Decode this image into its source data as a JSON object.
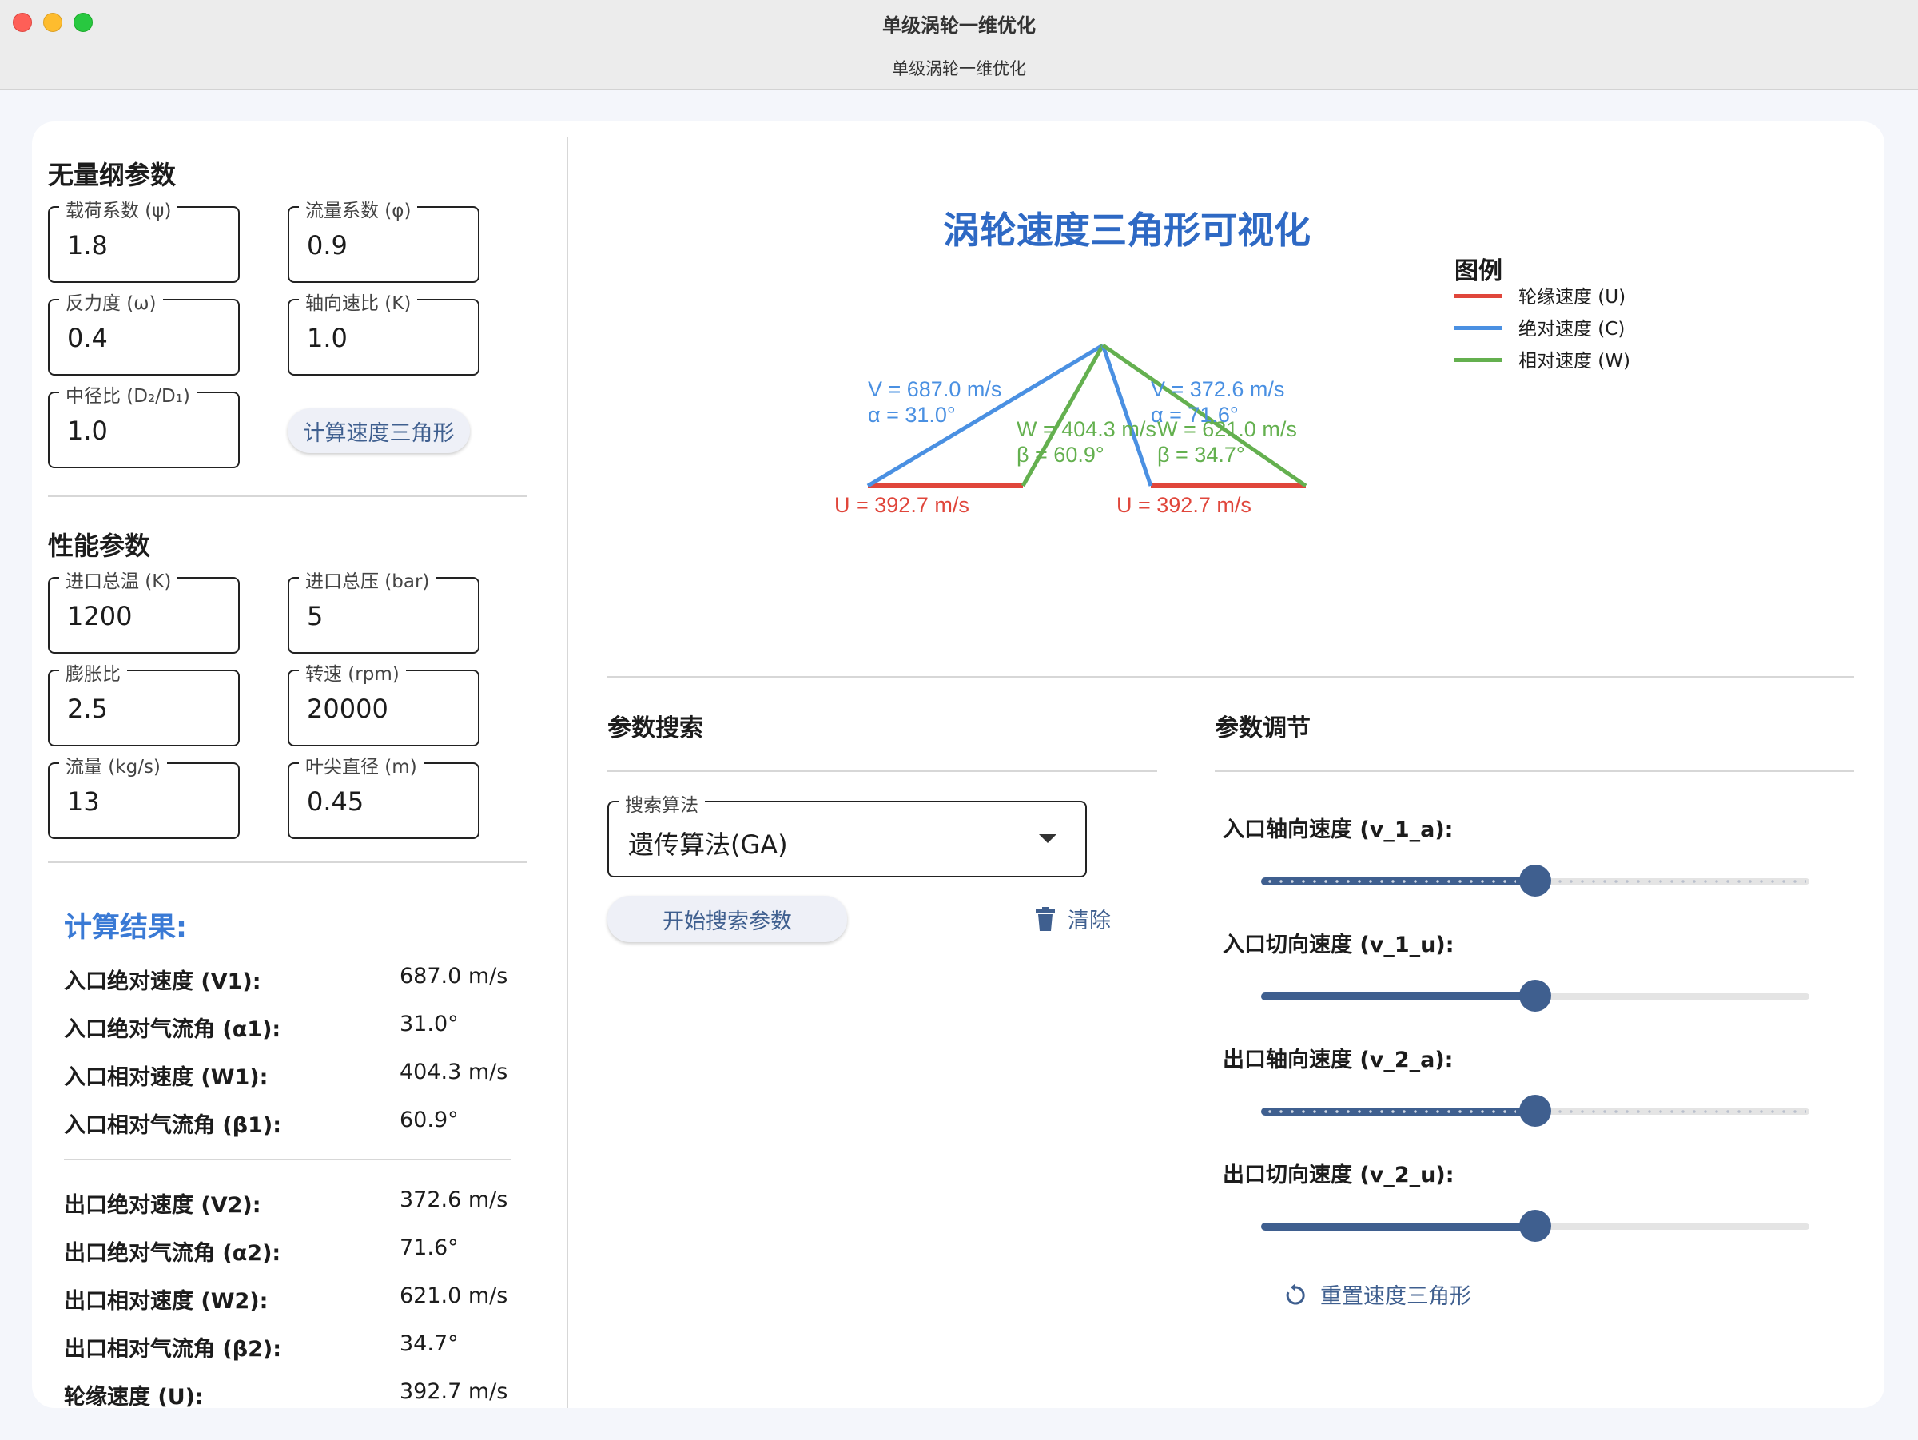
{
  "window": {
    "title": "单级涡轮一维优化",
    "subtitle": "单级涡轮一维优化"
  },
  "dimensionless": {
    "title": "无量纲参数",
    "fields": [
      {
        "label": "载荷系数 (ψ)",
        "value": "1.8"
      },
      {
        "label": "流量系数 (φ)",
        "value": "0.9"
      },
      {
        "label": "反力度 (ω)",
        "value": "0.4"
      },
      {
        "label": "轴向速比 (K)",
        "value": "1.0"
      },
      {
        "label": "中径比 (D₂/D₁)",
        "value": "1.0"
      }
    ],
    "calc_button": "计算速度三角形"
  },
  "performance": {
    "title": "性能参数",
    "fields": [
      {
        "label": "进口总温 (K)",
        "value": "1200"
      },
      {
        "label": "进口总压 (bar)",
        "value": "5"
      },
      {
        "label": "膨胀比",
        "value": "2.5"
      },
      {
        "label": "转速 (rpm)",
        "value": "20000"
      },
      {
        "label": "流量 (kg/s)",
        "value": "13"
      },
      {
        "label": "叶尖直径 (m)",
        "value": "0.45"
      }
    ]
  },
  "results": {
    "title": "计算结果:",
    "rows": [
      {
        "label": "入口绝对速度 (V1):",
        "value": "687.0 m/s"
      },
      {
        "label": "入口绝对气流角 (α1):",
        "value": "31.0°"
      },
      {
        "label": "入口相对速度 (W1):",
        "value": "404.3 m/s"
      },
      {
        "label": "入口相对气流角 (β1):",
        "value": "60.9°"
      },
      {
        "label": "出口绝对速度 (V2):",
        "value": "372.6 m/s"
      },
      {
        "label": "出口绝对气流角 (α2):",
        "value": "71.6°"
      },
      {
        "label": "出口相对速度 (W2):",
        "value": "621.0 m/s"
      },
      {
        "label": "出口相对气流角 (β2):",
        "value": "34.7°"
      },
      {
        "label": "轮缘速度 (U):",
        "value": "392.7 m/s"
      }
    ]
  },
  "chart": {
    "title": "涡轮速度三角形可视化",
    "legend_title": "图例",
    "legend": [
      {
        "label": "轮缘速度 (U)",
        "color": "#e0463b"
      },
      {
        "label": "绝对速度 (C)",
        "color": "#4a90e2"
      },
      {
        "label": "相对速度 (W)",
        "color": "#64b04f"
      }
    ],
    "inlet": {
      "v_label": "V = 687.0 m/s",
      "a_label": "α = 31.0°",
      "w_label": "W = 404.3 m/s",
      "b_label": "β = 60.9°",
      "u_label": "U = 392.7 m/s"
    },
    "outlet": {
      "v_label": "V = 372.6 m/s",
      "a_label": "α = 71.6°",
      "w_label": "W = 621.0 m/s",
      "b_label": "β = 34.7°",
      "u_label": "U = 392.7 m/s"
    },
    "colors": {
      "u": "#e0463b",
      "c": "#4a90e2",
      "w": "#64b04f"
    }
  },
  "search": {
    "title": "参数搜索",
    "algo_label": "搜索算法",
    "algo_value": "遗传算法(GA)",
    "start_button": "开始搜索参数",
    "clear_button": "清除"
  },
  "tuning": {
    "title": "参数调节",
    "sliders": [
      {
        "label": "入口轴向速度 (v_1_a):",
        "value": 0.5,
        "ticks": true
      },
      {
        "label": "入口切向速度 (v_1_u):",
        "value": 0.5,
        "ticks": false
      },
      {
        "label": "出口轴向速度 (v_2_a):",
        "value": 0.5,
        "ticks": true
      },
      {
        "label": "出口切向速度 (v_2_u):",
        "value": 0.5,
        "ticks": false
      }
    ],
    "reset_button": "重置速度三角形"
  }
}
